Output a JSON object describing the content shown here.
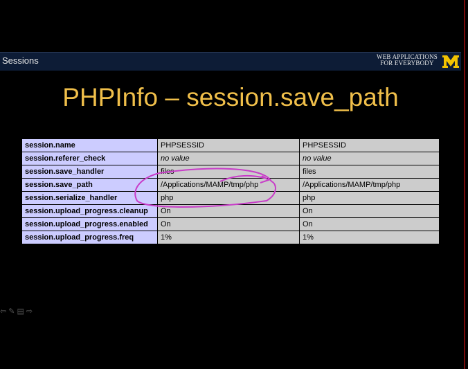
{
  "header": {
    "section": "Sessions",
    "brand_line1": "WEB APPLICATIONS",
    "brand_line2": "FOR EVERYBODY",
    "logo_letter": "M"
  },
  "slide": {
    "title": "PHPInfo – session.save_path"
  },
  "table": {
    "rows": [
      {
        "key": "session.name",
        "local": "PHPSESSID",
        "master": "PHPSESSID"
      },
      {
        "key": "session.referer_check",
        "local": "no value",
        "master": "no value"
      },
      {
        "key": "session.save_handler",
        "local": "files",
        "master": "files"
      },
      {
        "key": "session.save_path",
        "local": "/Applications/MAMP/tmp/php",
        "master": "/Applications/MAMP/tmp/php"
      },
      {
        "key": "session.serialize_handler",
        "local": "php",
        "master": "php"
      },
      {
        "key": "session.upload_progress.cleanup",
        "local": "On",
        "master": "On"
      },
      {
        "key": "session.upload_progress.enabled",
        "local": "On",
        "master": "On"
      },
      {
        "key": "session.upload_progress.freq",
        "local": "1%",
        "master": "1%"
      }
    ]
  },
  "colors": {
    "title": "#f0bf4a",
    "bar": "#0d1c36",
    "key_cell": "#ccccff",
    "value_cell": "#cccccc",
    "annotation": "#c83cc8",
    "logo": "#f2c200"
  },
  "toolbar": {
    "icons": [
      "back-arrow-icon",
      "pen-icon",
      "menu-icon",
      "forward-arrow-icon"
    ]
  }
}
